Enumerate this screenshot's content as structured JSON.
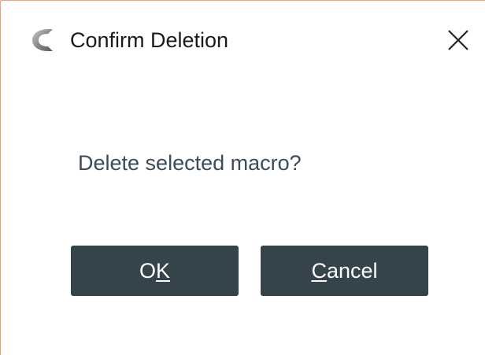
{
  "window": {
    "title": "Confirm Deletion",
    "app_icon": "app-logo-icon",
    "close_icon": "close-icon",
    "border_color": "#d8a88a"
  },
  "message": "Delete selected macro?",
  "buttons": {
    "ok": {
      "label_before": "O",
      "mnemonic": "K",
      "label_after": ""
    },
    "cancel": {
      "label_before": "",
      "mnemonic": "C",
      "label_after": "ancel"
    },
    "color": "#35434b"
  }
}
